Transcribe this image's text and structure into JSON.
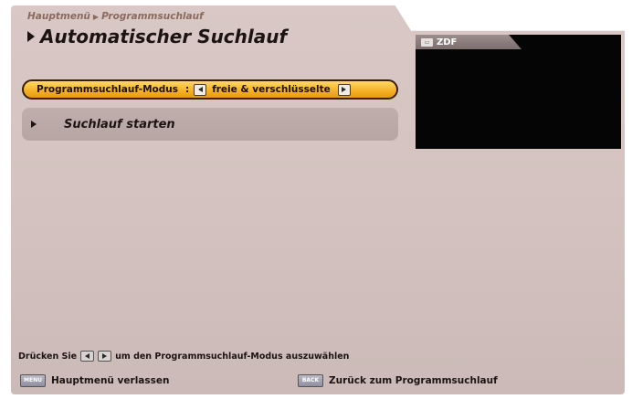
{
  "header": {
    "breadcrumb": [
      "Hauptmenü",
      "Programmsuchlauf"
    ],
    "title": "Automatischer Suchlauf"
  },
  "preview": {
    "channel_label": "ZDF"
  },
  "menu": {
    "mode_row": {
      "label": "Programmsuchlauf-Modus",
      "separator": ":",
      "value": "freie & verschlüsselte"
    },
    "start_row": {
      "label": "Suchlauf starten"
    }
  },
  "footer": {
    "hint_prefix": "Drücken Sie",
    "hint_suffix": "um den Programmsuchlauf-Modus auszuwählen",
    "menu_key_label": "MENU",
    "menu_action": "Hauptmenü verlassen",
    "back_key_label": "BACK",
    "back_action": "Zurück zum Programmsuchlauf"
  },
  "colors": {
    "background": "#d3c2bf",
    "selected_row": "#f4b023",
    "preview": "#050505"
  }
}
